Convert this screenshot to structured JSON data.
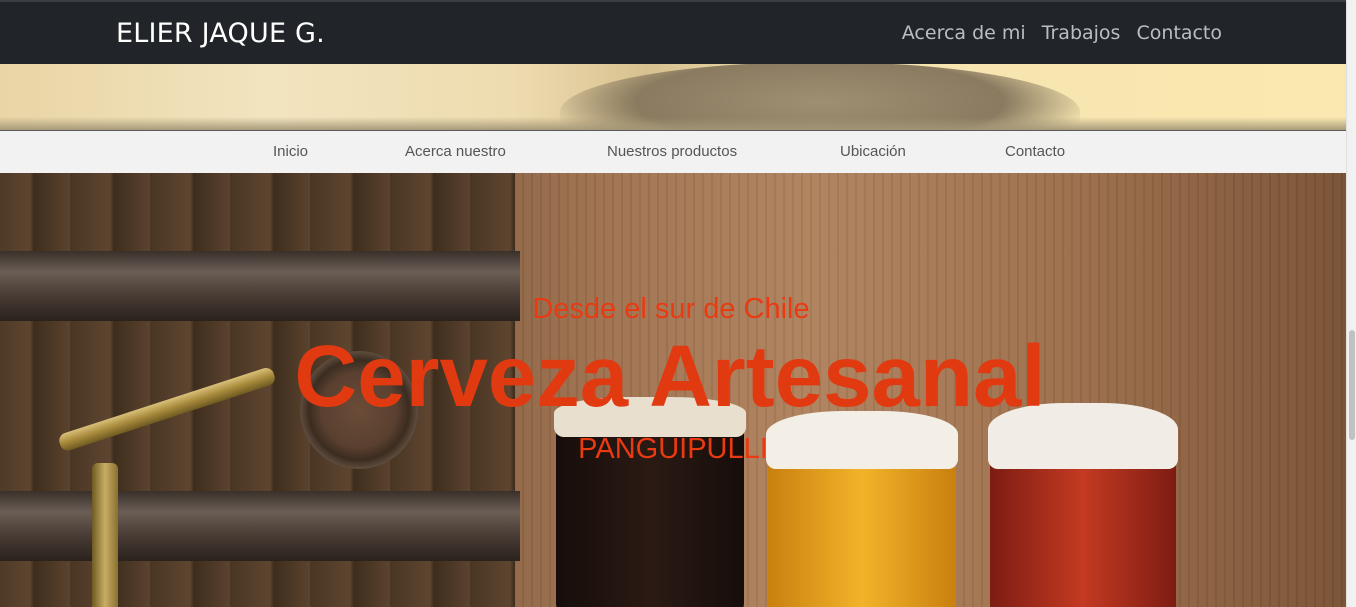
{
  "header": {
    "brand": "ELIER JAQUE G.",
    "nav": [
      "Acerca de mi",
      "Trabajos",
      "Contacto"
    ]
  },
  "subnav": {
    "items": [
      "Inicio",
      "Acerca nuestro",
      "Nuestros productos",
      "Ubicación",
      "Contacto"
    ]
  },
  "hero": {
    "subtitle": "Desde el sur de Chile",
    "title": "Cerveza Artesanal",
    "location": "PANGUIPULLI"
  },
  "colors": {
    "topbar_bg": "#212529",
    "hero_text": "#e23a10",
    "subnav_bg": "#f2f2f2"
  }
}
